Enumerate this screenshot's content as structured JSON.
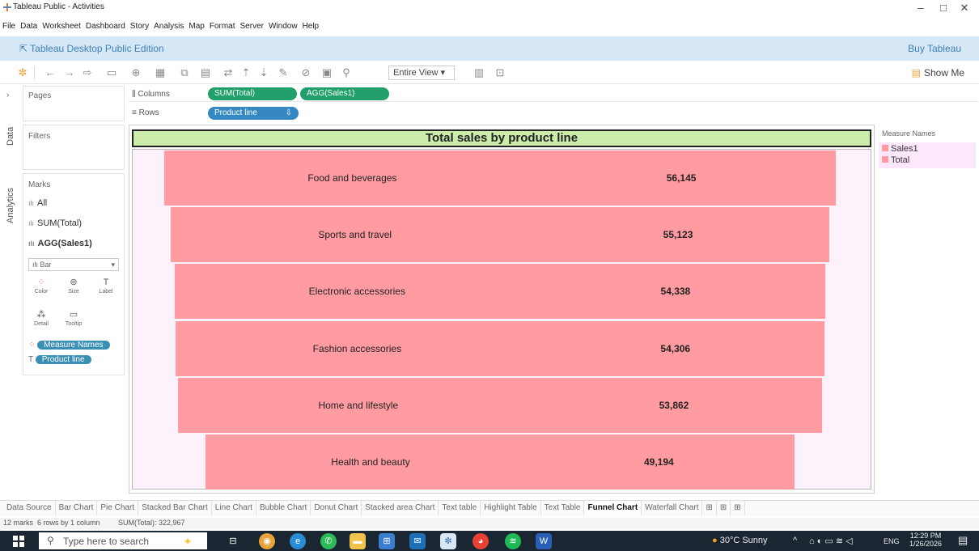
{
  "window": {
    "title": "Tableau Public - Activities",
    "controls": {
      "minimize": "–",
      "maximize": "□",
      "close": "✕"
    }
  },
  "menu": [
    "File",
    "Data",
    "Worksheet",
    "Dashboard",
    "Story",
    "Analysis",
    "Map",
    "Format",
    "Server",
    "Window",
    "Help"
  ],
  "banner": {
    "edition": "Tableau Desktop Public Edition",
    "buy": "Buy Tableau"
  },
  "toolbar": {
    "fit": "Entire View",
    "show_me": "Show Me"
  },
  "side_tabs": {
    "data": "Data",
    "analytics": "Analytics"
  },
  "pages": {
    "title": "Pages"
  },
  "filters": {
    "title": "Filters"
  },
  "marks": {
    "title": "Marks",
    "rows": [
      "All",
      "SUM(Total)",
      "AGG(Sales1)"
    ],
    "mark_type": "Bar",
    "cards": [
      {
        "label": "Color",
        "icon": "color-icon"
      },
      {
        "label": "Size",
        "icon": "size-icon"
      },
      {
        "label": "Label",
        "icon": "label-icon"
      },
      {
        "label": "Detail",
        "icon": "detail-icon"
      },
      {
        "label": "Tooltip",
        "icon": "tooltip-icon"
      }
    ],
    "fields": [
      "Measure Names",
      "Product line"
    ]
  },
  "shelves": {
    "columns_label": "Columns",
    "rows_label": "Rows",
    "columns_pills": [
      "SUM(Total)",
      "AGG(Sales1)"
    ],
    "rows_pills": [
      "Product line"
    ]
  },
  "legend": {
    "title": "Measure Names",
    "items": [
      "Sales1",
      "Total"
    ],
    "color": "#ff9ba1"
  },
  "chart_data": {
    "type": "bar",
    "title": "Total sales by product line",
    "categories": [
      "Food and beverages",
      "Sports and travel",
      "Electronic accessories",
      "Fashion accessories",
      "Home and lifestyle",
      "Health and beauty"
    ],
    "values": [
      56145,
      55123,
      54338,
      54306,
      53862,
      49194
    ],
    "value_labels": [
      "56,145",
      "55,123",
      "54,338",
      "54,306",
      "53,862",
      "49,194"
    ],
    "bar_color": "#ff9ba1",
    "background": "#fdf1fc",
    "title_background": "#ccecaa"
  },
  "sheet_tabs": [
    "Data Source",
    "Bar Chart",
    "Pie Chart",
    "Stacked Bar Chart",
    "Line Chart",
    "Bubble Chart",
    "Donut Chart",
    "Stacked area Chart",
    "Text table",
    "Highlight Table",
    "Text Table",
    "Funnel Chart",
    "Waterfall Chart"
  ],
  "active_tab": "Funnel Chart",
  "status": {
    "marks": "12 marks",
    "dims": "6 rows by 1 column",
    "sum": "SUM(Total): 322,967"
  },
  "taskbar": {
    "search_placeholder": "Type here to search",
    "weather": "30°C Sunny",
    "lang": "ENG",
    "time": "12:29 PM",
    "date": "1/26/2026"
  }
}
